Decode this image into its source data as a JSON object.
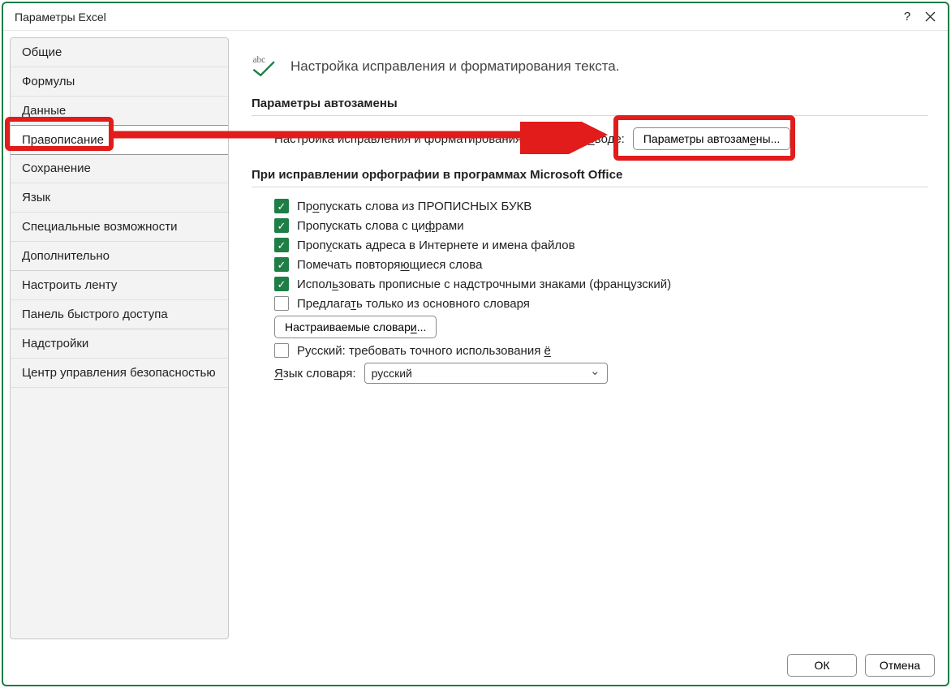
{
  "titlebar": {
    "title": "Параметры Excel"
  },
  "sidebar": {
    "items": [
      "Общие",
      "Формулы",
      "Данные",
      "Правописание",
      "Сохранение",
      "Язык",
      "Специальные возможности",
      "Дополнительно",
      "Настроить ленту",
      "Панель быстрого доступа",
      "Надстройки",
      "Центр управления безопасностью"
    ],
    "selected_index": 3
  },
  "content": {
    "header_text": "Настройка исправления и форматирования текста.",
    "section_autocorrect": {
      "title": "Параметры автозамены",
      "inline_label_before": "Настройка исправления и форматирования текста при ",
      "inline_label_uchar": "в",
      "inline_label_after": "воде:",
      "button": "Параметры автозам",
      "button_uchar": "е",
      "button_after": "ны..."
    },
    "section_spelling": {
      "title": "При исправлении орфографии в программах Microsoft Office",
      "checks": [
        {
          "checked": true,
          "pre": "Пр",
          "u": "о",
          "post": "пускать слова из ПРОПИСНЫХ БУКВ"
        },
        {
          "checked": true,
          "pre": "Пропускать слова с ци",
          "u": "ф",
          "post": "рами"
        },
        {
          "checked": true,
          "pre": "Проп",
          "u": "у",
          "post": "скать адреса в Интернете и имена файлов"
        },
        {
          "checked": true,
          "pre": "Помечать повторя",
          "u": "ю",
          "post": "щиеся слова"
        },
        {
          "checked": true,
          "pre": "Испол",
          "u": "ь",
          "post": "зовать прописные с надстрочными знаками (французский)"
        },
        {
          "checked": false,
          "pre": "Предлага",
          "u": "т",
          "post": "ь только из основного словаря"
        }
      ],
      "custom_dict_btn_pre": "Настраиваемые словар",
      "custom_dict_btn_u": "и",
      "custom_dict_btn_post": "...",
      "russian_check": {
        "checked": false,
        "pre": "Русский: требовать точного использования ",
        "u": "ё",
        "post": ""
      },
      "dict_lang_label_u": "Я",
      "dict_lang_label_post": "зык словаря:",
      "dict_lang_value": "русский"
    }
  },
  "footer": {
    "ok": "ОК",
    "cancel": "Отмена"
  }
}
